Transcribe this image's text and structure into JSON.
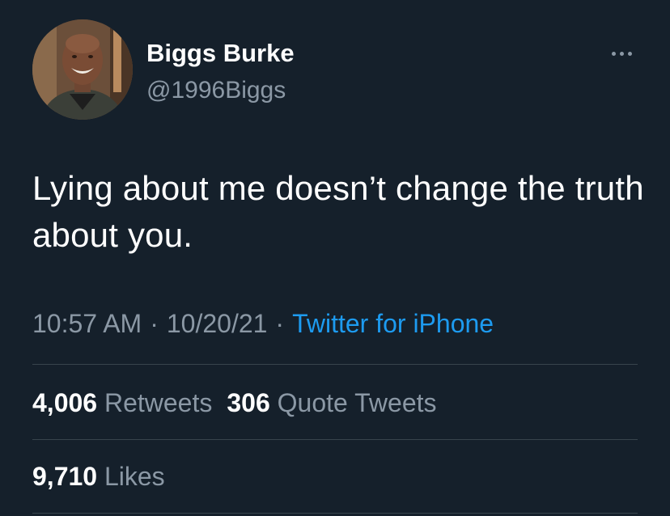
{
  "author": {
    "display_name": "Biggs Burke",
    "handle": "@1996Biggs"
  },
  "tweet": {
    "text": "Lying about me doesn’t change the truth about you.",
    "time": "10:57 AM",
    "date": "10/20/21",
    "separator": "·",
    "source": "Twitter for iPhone"
  },
  "stats": {
    "retweets": {
      "count": "4,006",
      "label": "Retweets"
    },
    "quote_tweets": {
      "count": "306",
      "label": "Quote Tweets"
    },
    "likes": {
      "count": "9,710",
      "label": "Likes"
    }
  },
  "icons": {
    "more": "more-horizontal-icon"
  },
  "colors": {
    "background": "#15202b",
    "primary_text": "#ffffff",
    "secondary_text": "#8b98a5",
    "link": "#1d9bf0",
    "divider": "#38444d"
  }
}
